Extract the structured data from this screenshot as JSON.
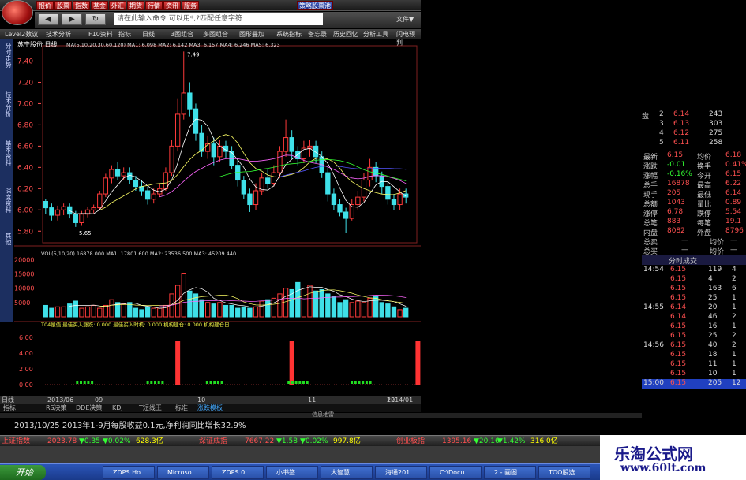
{
  "menu": {
    "items": [
      "报价",
      "股票",
      "指数",
      "基金",
      "外汇",
      "期货",
      "行情",
      "资讯",
      "服务"
    ],
    "selected": "策略股票池",
    "file": "文件▼"
  },
  "address": {
    "placeholder": "请在此输入命令     可以用*,?匹配任意字符"
  },
  "toolbar": [
    "Level2数议",
    "技术分析",
    "F10资料",
    "指标",
    "日线",
    "3图组合",
    "多图组合",
    "图形叠加",
    "系统指标",
    "备忘录",
    "历史回忆",
    "分析工具",
    "闪电预判"
  ],
  "left_nav": [
    "分时走势",
    "技术分析",
    "基本资料",
    "深度资料",
    "其他"
  ],
  "chart": {
    "title": "苏宁股份 日线",
    "ma_legend": "MA(5,10,20,30,60,120) MA1: 6.098  MA2: 6.142  MA3: 6.157  MA4: 6.246  MA5: 6.323",
    "high_label": "7.49",
    "low_label": "5.65",
    "yticks": [
      "7.40",
      "7.20",
      "7.00",
      "6.80",
      "6.60",
      "6.40",
      "6.20",
      "6.00",
      "5.80"
    ],
    "vol_legend": "VOL(5,10,20)  16878.000  MA1: 17801.600  MA2: 23536.500  MA3: 45209.440",
    "vol_ticks": [
      "20000",
      "15000",
      "10000",
      "5000"
    ],
    "ind_legend": "T04量值  最佳买入涨跌: 0.000  最佳买入时机: 0.000  机构建仓: 0.000  机构建仓日",
    "ind_ticks": [
      "6.00",
      "4.00",
      "2.00",
      "0.00"
    ],
    "date_labels": [
      "日线",
      "2013/06",
      "09",
      "10",
      "11",
      "12",
      "2014/01"
    ],
    "candles": [
      [
        6.08,
        6.02,
        6.1,
        5.96
      ],
      [
        6.02,
        5.95,
        6.06,
        5.9
      ],
      [
        5.95,
        6.0,
        6.04,
        5.9
      ],
      [
        6.0,
        6.03,
        6.06,
        5.95
      ],
      [
        6.03,
        5.96,
        6.06,
        5.92
      ],
      [
        5.96,
        5.88,
        5.99,
        5.84
      ],
      [
        5.88,
        5.96,
        5.99,
        5.85
      ],
      [
        5.96,
        6.0,
        6.03,
        5.93
      ],
      [
        6.0,
        6.02,
        6.05,
        5.97
      ],
      [
        6.02,
        6.15,
        6.18,
        6.0
      ],
      [
        6.15,
        6.3,
        6.34,
        6.12
      ],
      [
        6.3,
        6.38,
        6.42,
        6.25
      ],
      [
        6.38,
        6.32,
        6.45,
        6.28
      ],
      [
        6.32,
        6.35,
        6.4,
        6.28
      ],
      [
        6.35,
        6.28,
        6.4,
        6.24
      ],
      [
        6.28,
        6.22,
        6.32,
        6.18
      ],
      [
        6.22,
        6.18,
        6.28,
        6.13
      ],
      [
        6.18,
        6.1,
        6.22,
        6.05
      ],
      [
        6.1,
        6.15,
        6.2,
        6.06
      ],
      [
        6.15,
        6.2,
        6.24,
        6.12
      ],
      [
        6.2,
        6.35,
        6.4,
        6.18
      ],
      [
        6.35,
        6.6,
        6.66,
        6.32
      ],
      [
        6.6,
        6.9,
        7.05,
        6.55
      ],
      [
        6.9,
        7.1,
        7.49,
        6.85
      ],
      [
        7.1,
        6.95,
        7.2,
        6.88
      ],
      [
        6.95,
        6.72,
        7.0,
        6.65
      ],
      [
        6.72,
        6.55,
        6.8,
        6.5
      ],
      [
        6.55,
        6.62,
        6.7,
        6.48
      ],
      [
        6.62,
        6.5,
        6.68,
        6.42
      ],
      [
        6.5,
        6.6,
        6.66,
        6.45
      ],
      [
        6.6,
        6.55,
        6.65,
        6.48
      ],
      [
        6.55,
        6.42,
        6.6,
        6.38
      ],
      [
        6.42,
        6.28,
        6.47,
        6.22
      ],
      [
        6.28,
        6.15,
        6.32,
        6.1
      ],
      [
        6.15,
        6.05,
        6.2,
        5.98
      ],
      [
        6.05,
        6.18,
        6.25,
        6.0
      ],
      [
        6.18,
        6.3,
        6.35,
        6.14
      ],
      [
        6.3,
        6.25,
        6.38,
        6.2
      ],
      [
        6.25,
        6.35,
        6.42,
        6.22
      ],
      [
        6.35,
        6.55,
        6.6,
        6.3
      ],
      [
        6.55,
        6.68,
        6.85,
        6.5
      ],
      [
        6.68,
        6.55,
        6.75,
        6.48
      ],
      [
        6.55,
        6.48,
        6.6,
        6.42
      ],
      [
        6.48,
        6.58,
        6.65,
        6.44
      ],
      [
        6.58,
        6.6,
        6.66,
        6.5
      ],
      [
        6.6,
        6.5,
        6.65,
        6.44
      ],
      [
        6.5,
        6.35,
        6.55,
        6.3
      ],
      [
        6.35,
        6.15,
        6.4,
        6.08
      ],
      [
        6.15,
        6.05,
        6.2,
        6.0
      ],
      [
        6.05,
        5.98,
        6.1,
        5.94
      ],
      [
        5.98,
        5.92,
        6.02,
        5.78
      ],
      [
        5.92,
        6.05,
        6.1,
        5.9
      ],
      [
        6.05,
        6.12,
        6.18,
        6.0
      ],
      [
        6.12,
        6.28,
        6.35,
        6.08
      ],
      [
        6.28,
        6.4,
        6.48,
        6.22
      ],
      [
        6.4,
        6.32,
        6.45,
        6.26
      ],
      [
        6.32,
        6.22,
        6.36,
        6.15
      ],
      [
        6.22,
        6.1,
        6.26,
        6.05
      ],
      [
        6.1,
        6.05,
        6.15,
        6.0
      ],
      [
        6.05,
        6.15,
        6.2,
        6.0
      ],
      [
        6.15,
        6.12,
        6.2,
        6.06
      ]
    ],
    "volumes": [
      4000,
      3000,
      3500,
      3500,
      4500,
      5500,
      3000,
      3500,
      4000,
      3000,
      4000,
      6000,
      5000,
      4500,
      5000,
      3000,
      2500,
      3500,
      3000,
      3000,
      4000,
      8000,
      11000,
      15000,
      9000,
      8000,
      6000,
      5000,
      4500,
      5000,
      4000,
      4000,
      3000,
      3500,
      3000,
      3500,
      5500,
      6000,
      6500,
      8000,
      10000,
      9500,
      12000,
      10000,
      11000,
      9000,
      9500,
      8000,
      7000,
      5000,
      6000,
      5000,
      5500,
      5000,
      6500,
      7000,
      5000,
      4500,
      3500,
      2500,
      3000
    ],
    "signal_bars": [
      22,
      41,
      62,
      76
    ],
    "signal_value": 5.5
  },
  "quote": {
    "book": [
      [
        "盘",
        "2",
        "6.14",
        "243"
      ],
      [
        "",
        "3",
        "6.13",
        "303"
      ],
      [
        "",
        "4",
        "6.12",
        "275"
      ],
      [
        "",
        "5",
        "6.11",
        "258"
      ]
    ],
    "stats": [
      [
        "最新",
        "6.15",
        "均价",
        "6.18"
      ],
      [
        "涨跌",
        "-0.01",
        "换手",
        "0.41%"
      ],
      [
        "涨幅",
        "-0.16%",
        "今开",
        "6.15"
      ],
      [
        "总手",
        "16878",
        "最高",
        "6.22"
      ],
      [
        "现手",
        "205",
        "最低",
        "6.14"
      ],
      [
        "总额",
        "1043",
        "量比",
        "0.89"
      ],
      [
        "涨停",
        "6.78",
        "跌停",
        "5.54"
      ],
      [
        "总笔",
        "883",
        "每笔",
        "19.1"
      ],
      [
        "内盘",
        "8082",
        "外盘",
        "8796"
      ]
    ],
    "orders": [
      [
        "总卖",
        "—",
        "均价",
        "—"
      ],
      [
        "总买",
        "—",
        "均价",
        "—"
      ]
    ],
    "ticks_header": "分时成交",
    "ticks": [
      [
        "14:54",
        "6.15",
        "119",
        "4"
      ],
      [
        "",
        "6.15",
        "4",
        "2"
      ],
      [
        "",
        "6.15",
        "163",
        "6"
      ],
      [
        "",
        "6.15",
        "25",
        "1"
      ],
      [
        "14:55",
        "6.14",
        "20",
        "1"
      ],
      [
        "",
        "6.14",
        "46",
        "2"
      ],
      [
        "",
        "6.15",
        "16",
        "1"
      ],
      [
        "",
        "6.15",
        "25",
        "2"
      ],
      [
        "14:56",
        "6.15",
        "40",
        "2"
      ],
      [
        "",
        "6.15",
        "18",
        "1"
      ],
      [
        "",
        "6.15",
        "11",
        "1"
      ],
      [
        "",
        "6.15",
        "10",
        "1"
      ],
      [
        "15:00",
        "6.15",
        "205",
        "12"
      ]
    ]
  },
  "bottom_tabs": [
    "指标",
    "RS决策",
    "DDE决策",
    "KDJ",
    "T短线王",
    "标准",
    "涨跌模板"
  ],
  "infobar": "信息地雷",
  "news": "2013/10/25 2013年1-9月每股收益0.1元,净利润同比增长32.9%",
  "ticker": [
    [
      "上证指数",
      "2023.78",
      "▼0.35",
      "▼0.02%",
      "628.3亿"
    ],
    [
      "深证成指",
      "7667.22",
      "▼1.58",
      "▼0.02%",
      "997.8亿"
    ],
    [
      "创业板指",
      "1395.16",
      "▼20.16",
      "▼1.42%",
      "316.0亿"
    ]
  ],
  "taskbar": {
    "start": "开始",
    "items": [
      "ZDPS Ho",
      "Microso",
      "ZDPS 0",
      "小书签",
      "大智慧",
      "海通201",
      "C:\\Docu",
      "2 - 画图",
      "TOO股选"
    ]
  },
  "watermark": {
    "line1": "乐淘公式网",
    "line2": "www.60lt.com"
  },
  "colors": {
    "up": "#ff3a3a",
    "down": "#3fe0e8",
    "ma1": "#ffffff",
    "ma2": "#ffff66",
    "ma3": "#ff66ff",
    "ma4": "#33ff33",
    "ma5": "#5555ff",
    "signal": "#ff3333"
  }
}
